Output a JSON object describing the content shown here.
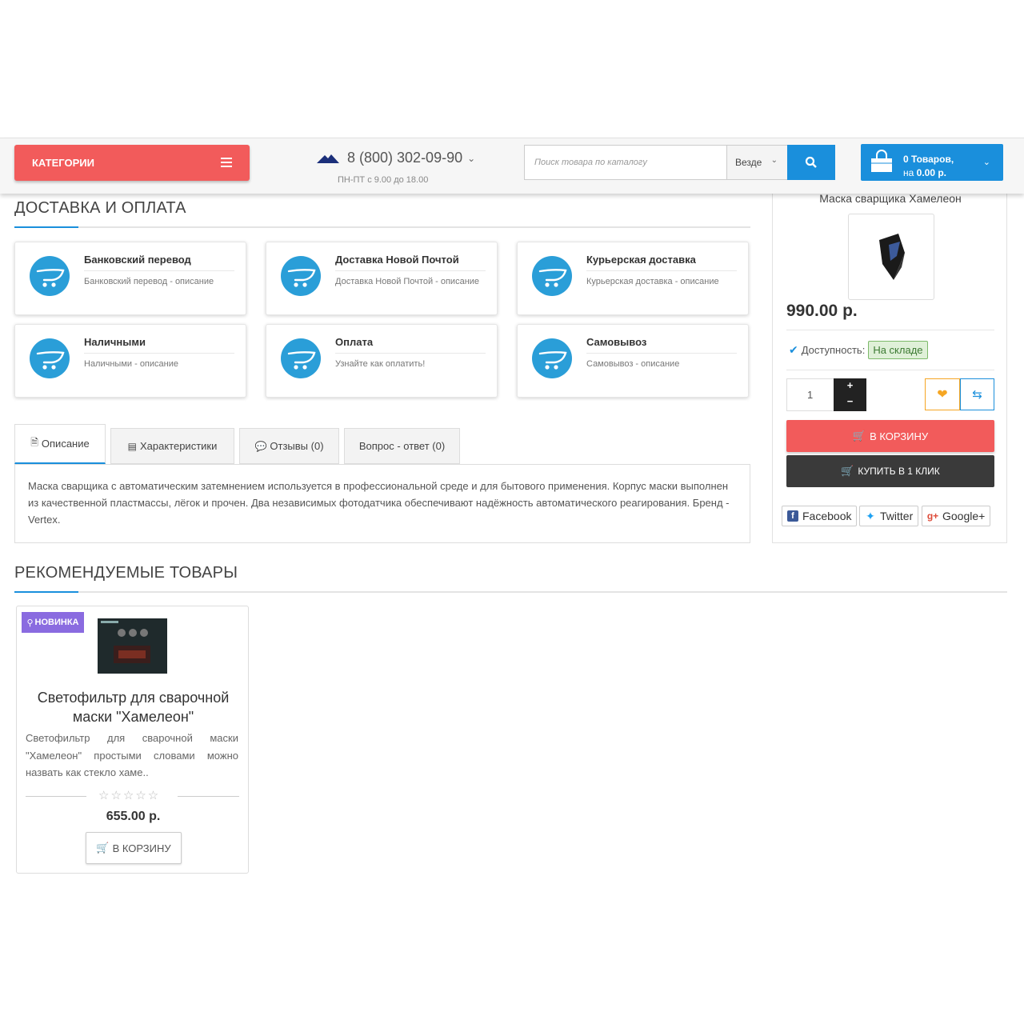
{
  "header": {
    "categories_label": "КАТЕГОРИИ",
    "phone": "8 (800) 302-09-90",
    "hours": "ПН-ПТ с 9.00 до 18.00",
    "search_placeholder": "Поиск товара по каталогу",
    "search_scope": "Везде",
    "cart_count": "0 Товаров,",
    "cart_prefix": "на",
    "cart_total": "0.00 р."
  },
  "delivery": {
    "title": "ДОСТАВКА И ОПЛАТА",
    "cards": [
      {
        "name": "Банковский перевод",
        "desc": "Банковский перевод - описание"
      },
      {
        "name": "Доставка Новой Почтой",
        "desc": "Доставка Новой Почтой - описание"
      },
      {
        "name": "Курьерская доставка",
        "desc": "Курьерская доставка - описание"
      },
      {
        "name": "Наличными",
        "desc": "Наличными - описание"
      },
      {
        "name": "Оплата",
        "desc": "Узнайте как оплатить!"
      },
      {
        "name": "Самовывоз",
        "desc": "Самовывоз - описание"
      }
    ]
  },
  "tabs": [
    {
      "label": "Описание"
    },
    {
      "label": "Характеристики"
    },
    {
      "label": "Отзывы (0)"
    },
    {
      "label": "Вопрос - ответ (0)"
    }
  ],
  "description": "Маска  сварщика с автоматическим затемнением используется в профессиональной среде и для бытового применения.  Корпус маски выполнен из качественной пластмассы, лёгок и прочен. Два независимых фотодатчика обеспечивают надёжность автоматического реагирования. Бренд - Vertex.",
  "product": {
    "name": "Маска сварщика Хамелеон",
    "price": "990.00 р.",
    "availability_label": "Доступность:",
    "availability_value": "На складе",
    "quantity": "1",
    "plus": "+",
    "minus": "−",
    "buy_label": "В КОРЗИНУ",
    "one_click_label": "КУПИТЬ В 1 КЛИК"
  },
  "share": {
    "facebook": "Facebook",
    "twitter": "Twitter",
    "google": "Google+"
  },
  "recommended": {
    "title": "РЕКОМЕНДУЕМЫЕ ТОВАРЫ",
    "items": [
      {
        "badge": "НОВИНКА",
        "title": "Светофильтр для сварочной маски \"Хамелеон\"",
        "text": "Светофильтр для сварочной маски \"Хамелеон\" простыми словами можно назвать как стекло хаме..",
        "stars": "☆☆☆☆☆",
        "price": "655.00 р.",
        "buy_label": "В КОРЗИНУ"
      }
    ]
  },
  "colors": {
    "accent_blue": "#1a8fdc",
    "accent_red": "#f25b5b",
    "dark_button": "#3a3a3a",
    "new_badge": "#8a6be0"
  }
}
